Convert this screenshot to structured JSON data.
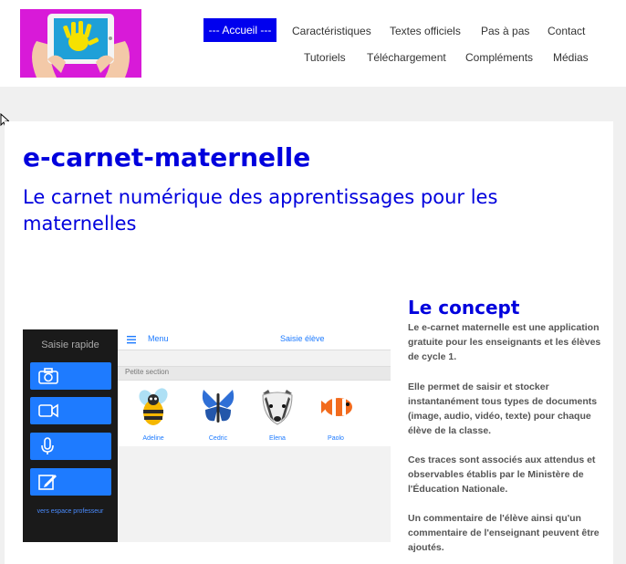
{
  "header": {
    "nav_active": "--- Accueil ---",
    "nav_row1": [
      "Caractéristiques",
      "Textes officiels",
      "Pas à pas",
      "Contact"
    ],
    "nav_row2": [
      "Tutoriels",
      "Téléchargement",
      "Compléments",
      "Médias"
    ]
  },
  "main": {
    "title": "e-carnet-maternelle",
    "subtitle": "Le carnet numérique des apprentissages pour les maternelles"
  },
  "app_screenshot": {
    "sidebar_title": "Saisie rapide",
    "sidebar_footer": "vers espace professeur",
    "menu_label": "Menu",
    "top_title": "Saisie élève",
    "section_label": "Petite section",
    "students": [
      "Adeline",
      "Cedric",
      "Elena",
      "Paolo"
    ]
  },
  "concept": {
    "title": "Le concept",
    "paragraphs": [
      " Le e-carnet maternelle est une application gratuite pour les enseignants et les élèves de cycle 1.",
      "Elle permet de saisir et stocker instantanément tous types de documents (image, audio, vidéo, texte) pour chaque élève de la classe.",
      "Ces traces sont associés aux attendus et observables établis par le Ministère de l'Éducation Nationale.",
      "Un commentaire de l'élève ainsi qu'un commentaire de l'enseignant peuvent être ajoutés."
    ]
  },
  "colors": {
    "accent_blue": "#0000dd",
    "nav_active_bg": "#0000ee",
    "logo_bg": "#d81ad8",
    "app_button": "#1e7bff"
  }
}
